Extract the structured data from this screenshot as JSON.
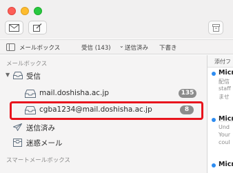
{
  "toolbar": {
    "traffic_colors": [
      "#fd5e57",
      "#febc2e",
      "#28c840"
    ],
    "buttons": [
      "get-mail",
      "compose",
      "archive"
    ]
  },
  "favorites_bar": {
    "mailboxes": "メールボックス",
    "inbox": "受信 (143)",
    "sent": "送信済み",
    "drafts": "下書き"
  },
  "sidebar": {
    "section_mailboxes": "メールボックス",
    "inbox_label": "受信",
    "accounts": [
      {
        "label": "mail.doshisha.ac.jp",
        "count": "135"
      },
      {
        "label": "cgba1234@mail.doshisha.ac.jp",
        "count": "8"
      }
    ],
    "sent_label": "送信済み",
    "junk_label": "迷惑メール",
    "section_smart": "スマートメールボックス"
  },
  "message_list": {
    "header": "添付フ",
    "items": [
      {
        "from": "Micr",
        "lines": [
          "配信",
          "staff",
          "ませ"
        ]
      },
      {
        "from": "Micr",
        "lines": [
          "Und",
          "Your",
          "coul"
        ]
      },
      {
        "from": "Micr",
        "lines": []
      }
    ]
  },
  "highlight_color": "#e8141d"
}
